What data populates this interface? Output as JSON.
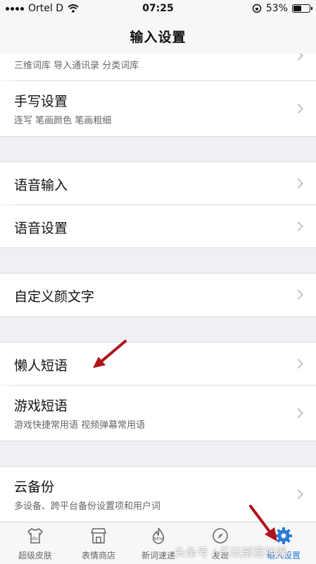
{
  "status_bar": {
    "carrier": "Ortel D",
    "time": "07:25",
    "battery": "53%",
    "battery_level": 0.53
  },
  "header": {
    "title": "输入设置"
  },
  "rows": [
    {
      "sub": "三维词库 导入通讯录 分类词库"
    },
    {
      "label": "手写设置",
      "sub": "连写 笔画颜色 笔画粗细"
    },
    {
      "label": "语音输入"
    },
    {
      "label": "语音设置"
    },
    {
      "label": "自定义颜文字"
    },
    {
      "label": "懒人短语"
    },
    {
      "label": "游戏短语",
      "sub": "游戏快捷常用语 视频弹幕常用语"
    },
    {
      "label": "云备份",
      "sub": "多设备、跨平台备份设置项和用户词"
    }
  ],
  "tabs": [
    {
      "label": "超级皮肤",
      "icon": "tshirt-icon"
    },
    {
      "label": "表情商店",
      "icon": "shop-icon"
    },
    {
      "label": "新词速递",
      "icon": "new-fire-icon",
      "badge": "NEW"
    },
    {
      "label": "发现",
      "icon": "compass-icon"
    },
    {
      "label": "输入设置",
      "icon": "gear-icon",
      "active": true
    }
  ],
  "watermark": "头条号 / 乐玩部落神器",
  "colors": {
    "accent": "#2a7bd6",
    "arrow": "#b0121b"
  }
}
